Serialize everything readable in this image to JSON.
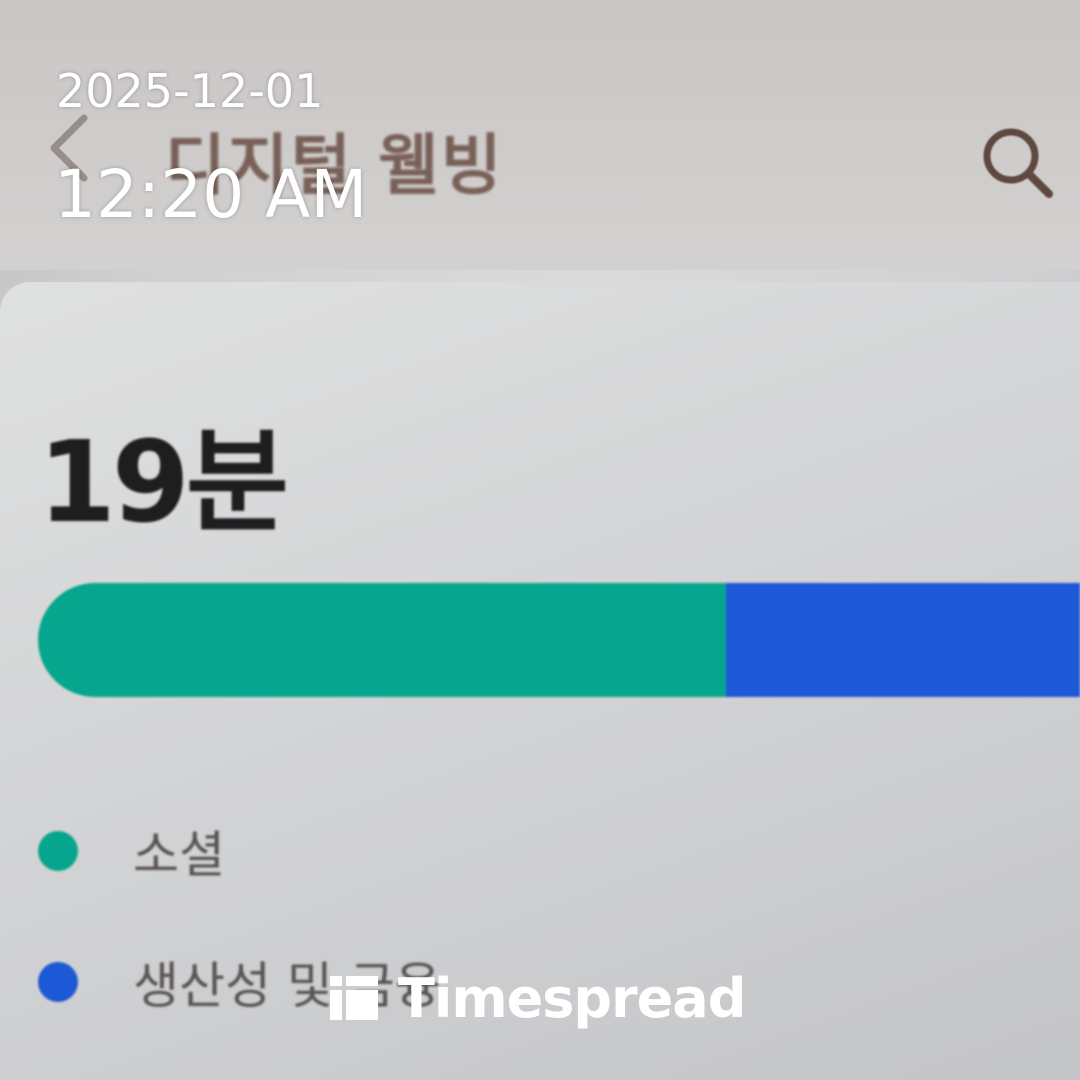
{
  "header": {
    "back_icon": "chevron-left-icon",
    "title": "디지털 웰빙",
    "search_icon": "search-icon",
    "title_color": "#6a4e44"
  },
  "usage": {
    "total_time": "19분",
    "segments": [
      {
        "label": "소셜",
        "color": "#06a58e",
        "share": 0.66
      },
      {
        "label": "생산성 및 금융",
        "color": "#1d58d6",
        "share": 0.34
      }
    ]
  },
  "overlay": {
    "date": "2025-12-01",
    "time": "12:20 AM",
    "watermark": "Timespread"
  }
}
